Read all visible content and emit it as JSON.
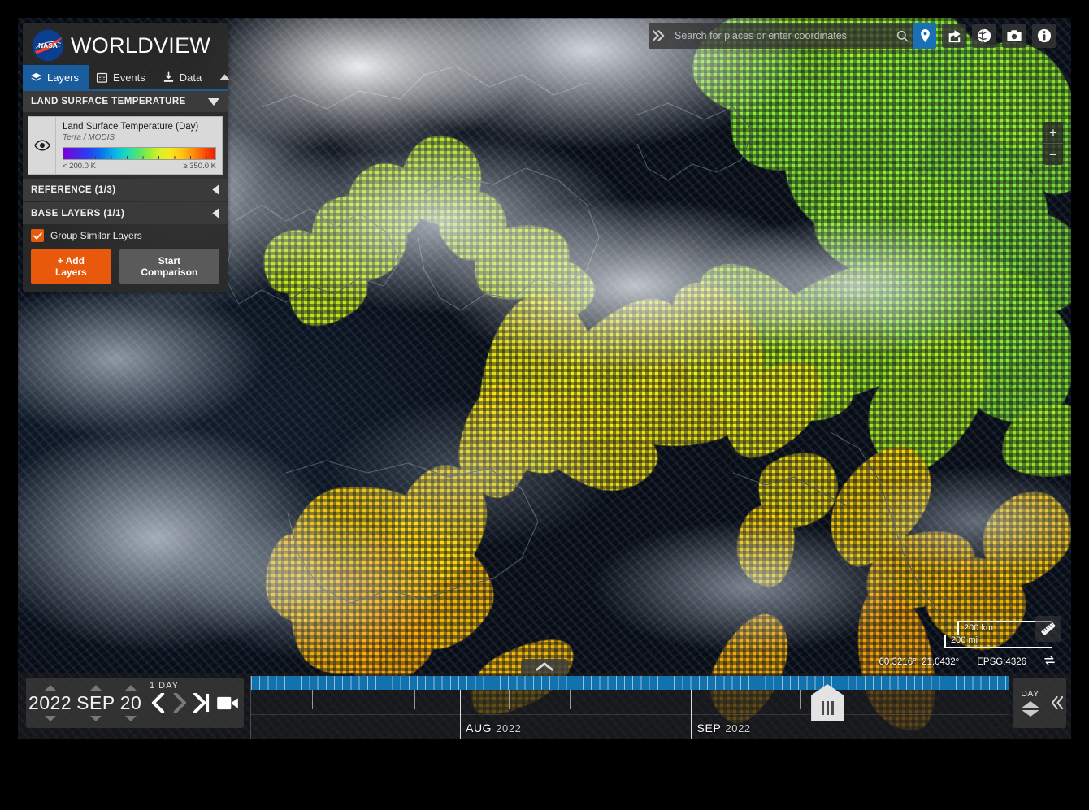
{
  "app": {
    "brand": "WORLDVIEW",
    "brand_first_letter": "W",
    "brand_rest": "ORLDVIEW",
    "logo": "nasa-meatball-logo",
    "accent_blue": "#1a5d9e",
    "accent_orange": "#e8590c",
    "timeline_blue": "#1272ad"
  },
  "tabs": [
    {
      "id": "layers",
      "label": "Layers",
      "icon": "layers-icon",
      "active": true
    },
    {
      "id": "events",
      "label": "Events",
      "icon": "calendar-icon",
      "active": false
    },
    {
      "id": "data",
      "label": "Data",
      "icon": "download-icon",
      "active": false
    }
  ],
  "sidebar": {
    "collapse_icon": "chevron-up-icon",
    "groups": [
      {
        "id": "lst",
        "title": "LAND SURFACE TEMPERATURE",
        "state_icon": "chevron-down-icon",
        "expanded": true
      },
      {
        "id": "reference",
        "title": "REFERENCE (1/3)",
        "state_icon": "chevron-left-icon",
        "expanded": false
      },
      {
        "id": "base",
        "title": "BASE LAYERS (1/1)",
        "state_icon": "chevron-left-icon",
        "expanded": false
      }
    ],
    "layer": {
      "visibility_icon": "eye-icon",
      "name": "Land Surface Temperature (Day)",
      "source": "Terra / MODIS",
      "legend_min": "< 200.0 K",
      "legend_max": "≥ 350.0 K",
      "palette": "rainbow"
    },
    "group_similar": {
      "label": "Group Similar Layers",
      "checked": true,
      "check_icon": "check-icon"
    },
    "add_layers_button": "+ Add Layers",
    "start_comparison_button": "Start Comparison"
  },
  "search": {
    "placeholder": "Search for places or enter coordinates",
    "value": "",
    "expand_icon": "chevrons-right-icon",
    "search_icon": "search-icon",
    "pin_icon": "map-pin-icon"
  },
  "toolbar_icons": [
    {
      "id": "share",
      "name": "share-icon"
    },
    {
      "id": "projection",
      "name": "globe-icon"
    },
    {
      "id": "snapshot",
      "name": "camera-icon"
    },
    {
      "id": "info",
      "name": "info-icon"
    }
  ],
  "map": {
    "zoom_in": "+",
    "zoom_out": "−",
    "scale_km": "200 km",
    "scale_mi": "200 mi",
    "coordinates": "60.3216°, 21.0432°",
    "projection": "EPSG:4326",
    "swap_icon": "swap-icon",
    "measure_icon": "ruler-icon"
  },
  "timeline": {
    "collapse_icon": "chevron-up-icon",
    "date": {
      "year": "2022",
      "month": "SEP",
      "day": "20"
    },
    "interval_label": "1  DAY",
    "controls": [
      {
        "id": "prev",
        "name": "step-backward-icon"
      },
      {
        "id": "next",
        "name": "step-forward-icon"
      },
      {
        "id": "jump-end",
        "name": "skip-to-end-icon"
      },
      {
        "id": "animate",
        "name": "video-camera-icon"
      }
    ],
    "months": [
      {
        "label": "AUG",
        "year": "2022",
        "pos_pct": 27.5
      },
      {
        "label": "SEP",
        "year": "2022",
        "pos_pct": 58.0
      }
    ],
    "handle_pos_pct": 76.0,
    "unit_label": "DAY",
    "unit_up_icon": "chevron-up-icon",
    "unit_down_icon": "chevron-down-icon",
    "back_icon": "chevrons-left-icon"
  }
}
